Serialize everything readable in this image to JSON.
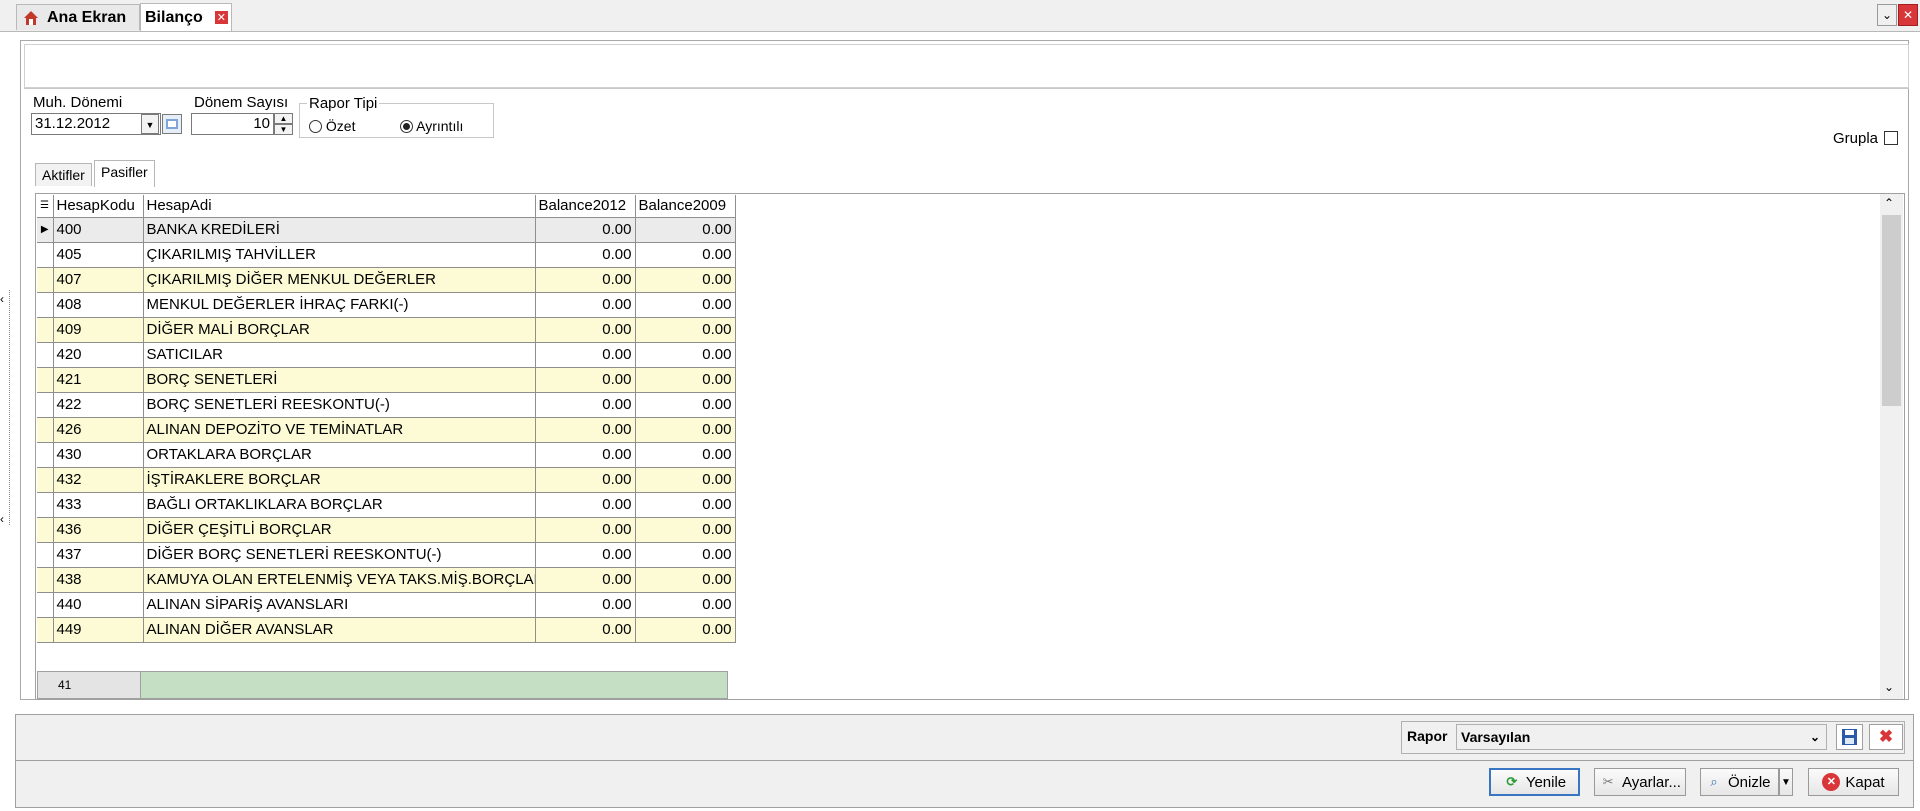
{
  "tabs": {
    "home_label": "Ana Ekran",
    "active_label": "Bilanço"
  },
  "filters": {
    "period_label": "Muh. Dönemi",
    "period_value": "31.12.2012",
    "period_count_label": "Dönem Sayısı",
    "period_count_value": "10",
    "report_type_label": "Rapor Tipi",
    "report_type_options": [
      "Özet",
      "Ayrıntılı"
    ],
    "report_type_selected": "Ayrıntılı",
    "group_label": "Grupla"
  },
  "inner_tabs": [
    "Aktifler",
    "Pasifler"
  ],
  "inner_tab_selected": "Pasifler",
  "grid": {
    "columns": [
      "HesapKodu",
      "HesapAdi",
      "Balance2012",
      "Balance2009"
    ],
    "rows": [
      [
        "400",
        "BANKA KREDİLERİ",
        "0.00",
        "0.00"
      ],
      [
        "405",
        "ÇIKARILMIŞ TAHVİLLER",
        "0.00",
        "0.00"
      ],
      [
        "407",
        "ÇIKARILMIŞ DİĞER MENKUL DEĞERLER",
        "0.00",
        "0.00"
      ],
      [
        "408",
        "MENKUL DEĞERLER İHRAÇ FARKI(-)",
        "0.00",
        "0.00"
      ],
      [
        "409",
        "DİĞER MALİ BORÇLAR",
        "0.00",
        "0.00"
      ],
      [
        "420",
        "SATICILAR",
        "0.00",
        "0.00"
      ],
      [
        "421",
        "BORÇ SENETLERİ",
        "0.00",
        "0.00"
      ],
      [
        "422",
        "BORÇ SENETLERİ REESKONTU(-)",
        "0.00",
        "0.00"
      ],
      [
        "426",
        "ALINAN DEPOZİTO VE TEMİNATLAR",
        "0.00",
        "0.00"
      ],
      [
        "430",
        "ORTAKLARA BORÇLAR",
        "0.00",
        "0.00"
      ],
      [
        "432",
        "İŞTİRAKLERE BORÇLAR",
        "0.00",
        "0.00"
      ],
      [
        "433",
        "BAĞLI ORTAKLIKLARA BORÇLAR",
        "0.00",
        "0.00"
      ],
      [
        "436",
        "DİĞER ÇEŞİTLİ BORÇLAR",
        "0.00",
        "0.00"
      ],
      [
        "437",
        "DİĞER BORÇ SENETLERİ REESKONTU(-)",
        "0.00",
        "0.00"
      ],
      [
        "438",
        "KAMUYA OLAN ERTELENMİŞ VEYA TAKS.MİŞ.BORÇLAR",
        "0.00",
        "0.00"
      ],
      [
        "440",
        "ALINAN SİPARİŞ AVANSLARI",
        "0.00",
        "0.00"
      ],
      [
        "449",
        "ALINAN DİĞER AVANSLAR",
        "0.00",
        "0.00"
      ]
    ],
    "footer_count": "41"
  },
  "report": {
    "label": "Rapor",
    "value": "Varsayılan"
  },
  "buttons": {
    "refresh": "Yenile",
    "settings": "Ayarlar...",
    "preview": "Önizle",
    "close": "Kapat"
  },
  "colors": {
    "row_alt": "#fcfbd6",
    "footer": "#c4dfc4",
    "close_red": "#d9363a",
    "accent_blue": "#3a75c4"
  }
}
